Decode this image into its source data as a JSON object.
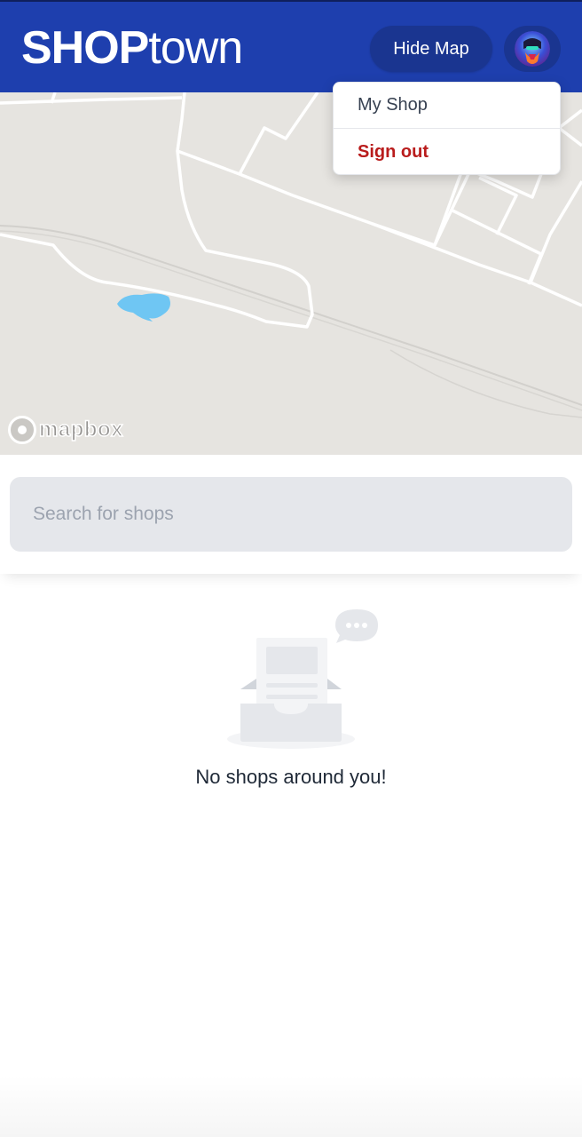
{
  "header": {
    "logo_bold": "SHOP",
    "logo_light": "town",
    "hide_map_label": "Hide Map",
    "brand_color": "#1e3fae"
  },
  "account_menu": {
    "items": [
      {
        "label": "My Shop"
      },
      {
        "label": "Sign out",
        "color": "#b91c1c"
      }
    ]
  },
  "map": {
    "attribution": "mapbox"
  },
  "search": {
    "placeholder": "Search for shops",
    "value": ""
  },
  "results": {
    "empty_message": "No shops around you!"
  }
}
